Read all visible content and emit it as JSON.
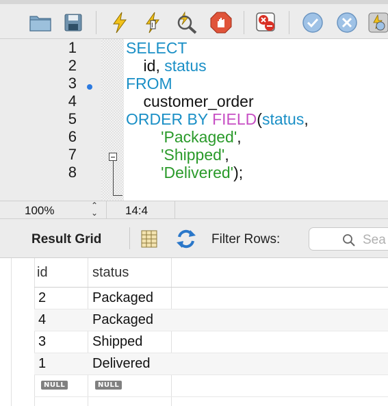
{
  "toolbar": {
    "buttons": [
      {
        "name": "open-folder-icon"
      },
      {
        "name": "save-icon"
      },
      {
        "name": "execute-lightning-icon"
      },
      {
        "name": "execute-current-lightning-icon"
      },
      {
        "name": "explain-magnifier-icon"
      },
      {
        "name": "stop-hand-icon"
      },
      {
        "name": "toggle-error-icon"
      },
      {
        "name": "commit-check-icon"
      },
      {
        "name": "rollback-x-icon"
      },
      {
        "name": "autocommit-icon"
      }
    ]
  },
  "editor": {
    "line_numbers": [
      "1",
      "2",
      "3",
      "4",
      "5",
      "6",
      "7",
      "8"
    ],
    "lines": [
      [
        {
          "t": "SELECT",
          "c": "kw"
        }
      ],
      [
        {
          "t": "    id, ",
          "c": "plain"
        },
        {
          "t": "status",
          "c": "kw"
        }
      ],
      [
        {
          "t": "FROM",
          "c": "kw"
        }
      ],
      [
        {
          "t": "    customer_order",
          "c": "plain"
        }
      ],
      [
        {
          "t": "ORDER BY ",
          "c": "kw"
        },
        {
          "t": "FIELD",
          "c": "fn"
        },
        {
          "t": "(",
          "c": "plain"
        },
        {
          "t": "status",
          "c": "kw"
        },
        {
          "t": ",",
          "c": "plain"
        }
      ],
      [
        {
          "t": "        ",
          "c": "plain"
        },
        {
          "t": "'Packaged'",
          "c": "str"
        },
        {
          "t": ",",
          "c": "plain"
        }
      ],
      [
        {
          "t": "        ",
          "c": "plain"
        },
        {
          "t": "'Shipped'",
          "c": "str"
        },
        {
          "t": ",",
          "c": "plain"
        }
      ],
      [
        {
          "t": "        ",
          "c": "plain"
        },
        {
          "t": "'Delivered'",
          "c": "str"
        },
        {
          "t": ");",
          "c": "plain"
        }
      ]
    ]
  },
  "status_bar": {
    "zoom": "100%",
    "stepper_up": "⌃",
    "stepper_down": "⌄",
    "cursor_position": "14:4"
  },
  "results_toolbar": {
    "result_grid_label": "Result Grid",
    "filter_rows_label": "Filter Rows:",
    "search_placeholder": "Sea"
  },
  "grid": {
    "columns": [
      "id",
      "status"
    ],
    "rows": [
      [
        "2",
        "Packaged"
      ],
      [
        "4",
        "Packaged"
      ],
      [
        "3",
        "Shipped"
      ],
      [
        "1",
        "Delivered"
      ]
    ],
    "null_label": "NULL"
  }
}
